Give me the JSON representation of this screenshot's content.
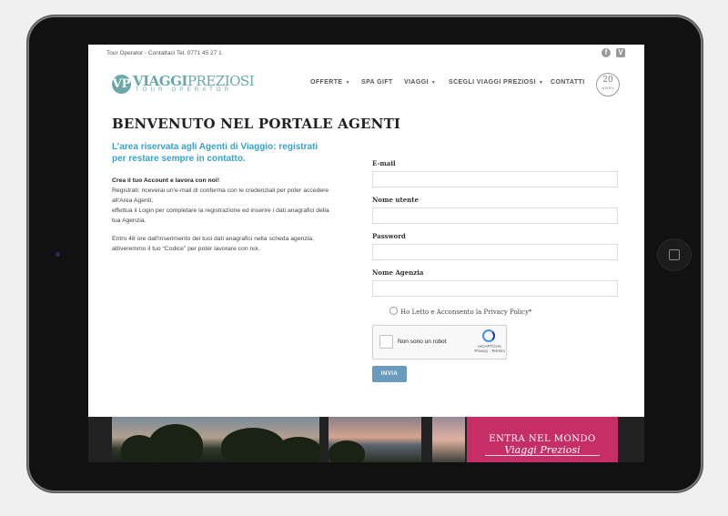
{
  "topbar": {
    "contact": "Tour Operator - Contattaci Tel. 0771 45 27 1",
    "social": {
      "facebook_icon": "f",
      "vimeo_icon": "V"
    }
  },
  "logo": {
    "monogram": "VP",
    "word_bold": "VIAGGI",
    "word_light": "PREZIOSI",
    "sub": "TOUR OPERATOR"
  },
  "nav": {
    "items": [
      {
        "label": "OFFERTE",
        "dropdown": true
      },
      {
        "label": "SPA GIFT",
        "dropdown": false
      },
      {
        "label": "VIAGGI",
        "dropdown": true
      },
      {
        "label": "SCEGLI VIAGGI PREZIOSI",
        "dropdown": true
      },
      {
        "label": "CONTATTI",
        "dropdown": false
      }
    ],
    "chevron": "▼"
  },
  "badge": {
    "number": "20",
    "caption": "ANNI"
  },
  "content": {
    "title": "BENVENUTO NEL PORTALE AGENTI",
    "subtitle": "L’area riservata agli Agenti di Viaggio: registrati per restare sempre in contatto.",
    "p1_bold": "Crea il tuo Account e lavora con noi!",
    "p1_line2": "Registrati: riceverai un'e-mail di conferma con le credenziali per poter accedere all'Area Agenti,",
    "p1_line3": "effettua il Login per completare la registrazione ed inserire i dati anagrafici della tua Agenzia.",
    "p2": "Entro 48 ore dall'inserimento dei tuoi dati anagrafici nella scheda agenzia, attiveremmo il tuo “Codice” per poter lavorare con noi."
  },
  "form": {
    "email_label": "E-mail",
    "email_value": "",
    "username_label": "Nome utente",
    "username_value": "",
    "password_label": "Password",
    "password_value": "",
    "agency_label": "Nome Agenzia",
    "agency_value": "",
    "privacy_label": "Ho Letto e Acconsento la Privacy Policy*",
    "recaptcha_label": "Non sono un robot",
    "recaptcha_brand": "reCAPTCHA",
    "recaptcha_links": "Privacy - Termini",
    "submit_label": "INVIA"
  },
  "banner": {
    "line1": "ENTRA NEL MONDO",
    "line2": "Viaggi Preziosi"
  },
  "colors": {
    "brand": "#6aa9a7",
    "accent": "#3aa2c8",
    "button": "#6a9bbf",
    "banner_pink": "#c62f66"
  }
}
